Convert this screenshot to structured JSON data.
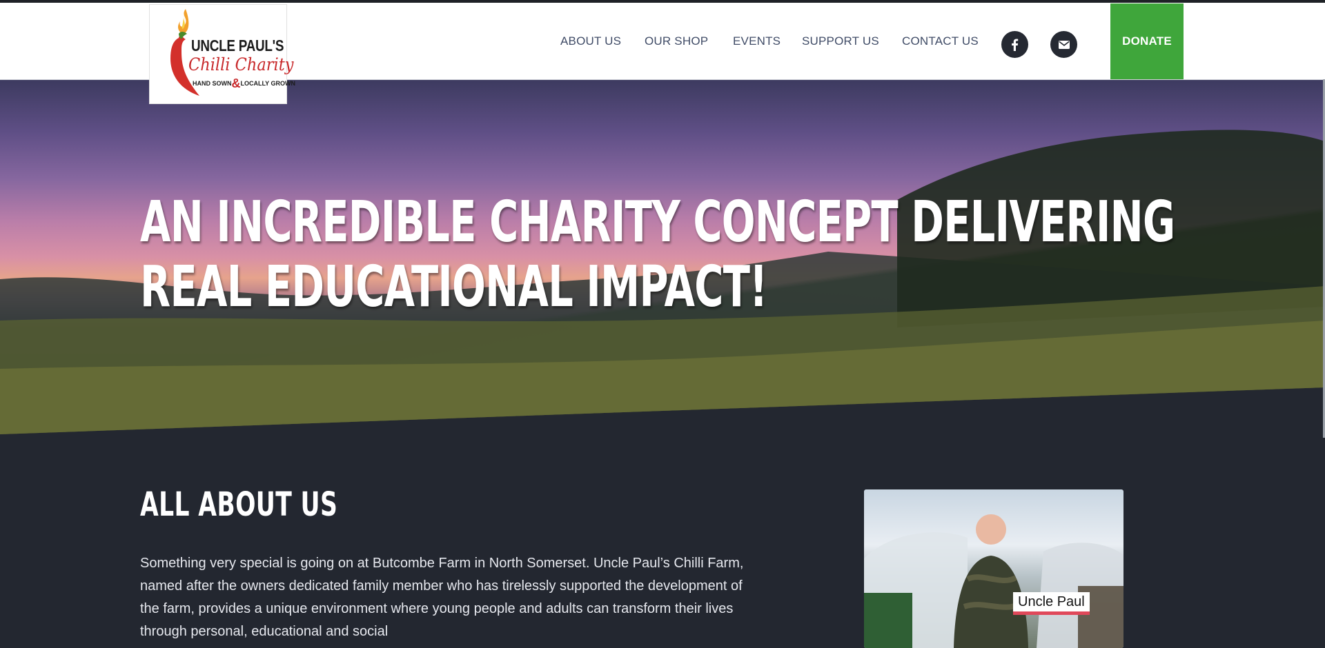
{
  "logo": {
    "line1": "UNCLE PAUL'S",
    "line2": "Chilli Charity",
    "line3_a": "HAND SOWN",
    "line3_amp": "&",
    "line3_b": "LOCALLY GROWN"
  },
  "nav": {
    "items": [
      "ABOUT US",
      "OUR SHOP",
      "EVENTS",
      "SUPPORT US",
      "CONTACT US"
    ],
    "facebook_icon": "facebook-icon",
    "email_icon": "envelope-icon",
    "donate_label": "DONATE"
  },
  "hero": {
    "title_line1": "AN INCREDIBLE CHARITY CONCEPT DELIVERING",
    "title_line2": "REAL EDUCATIONAL IMPACT!"
  },
  "about": {
    "title": "ALL ABOUT US",
    "text": "Something very special is going on at Butcombe Farm in North Somerset.  Uncle Paul’s Chilli Farm, named after the owners dedicated family member who has tirelessly supported the development of the farm, provides a unique environment where young people and adults can transform their lives through personal, educational and social",
    "photo_label": "Uncle Paul"
  },
  "colors": {
    "nav_text": "#3f4b66",
    "donate": "#3fa63b",
    "dark_bg": "#232730",
    "label_accent": "#e0485a"
  }
}
